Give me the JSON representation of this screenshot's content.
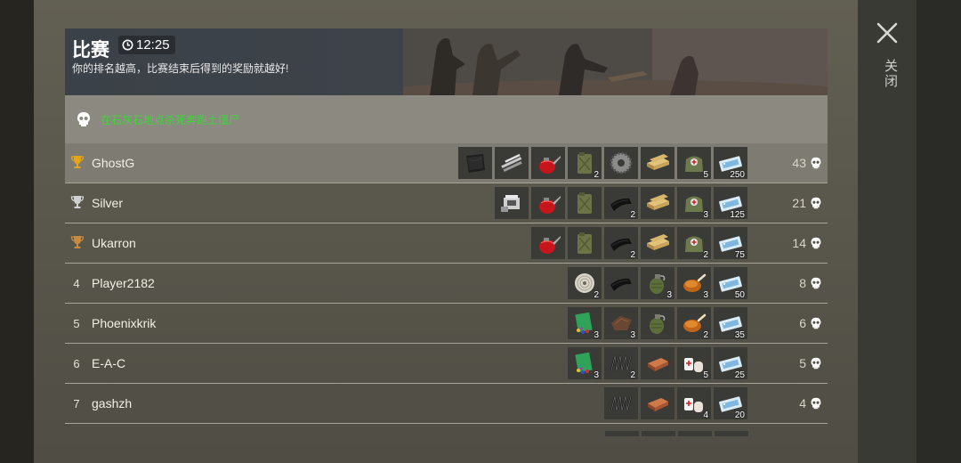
{
  "header": {
    "title": "比赛",
    "timer": "12:25",
    "subtitle": "你的排名越高，比赛结束后得到的奖励就越好!"
  },
  "task": {
    "text": "在石灰石地点杀死奔跑土僵尸"
  },
  "close": {
    "label": "关闭"
  },
  "colors": {
    "gold": "#e6a417",
    "silver": "#d0d0d0",
    "bronze": "#c88a40",
    "task_green": "#3ed43a"
  },
  "rows": [
    {
      "rank": "",
      "trophy": "gold",
      "name": "GhostG",
      "score": "43",
      "items": [
        {
          "icon": "leather-icon",
          "count": ""
        },
        {
          "icon": "pipes-icon",
          "count": ""
        },
        {
          "icon": "oil-can-icon",
          "count": ""
        },
        {
          "icon": "jerrycan-icon",
          "count": "2"
        },
        {
          "icon": "gear-icon",
          "count": ""
        },
        {
          "icon": "plank-icon",
          "count": ""
        },
        {
          "icon": "medkit-bag-icon",
          "count": "5"
        },
        {
          "icon": "coupon-icon",
          "count": "250"
        }
      ]
    },
    {
      "rank": "",
      "trophy": "silver",
      "name": "Silver",
      "score": "21",
      "items": [
        {
          "icon": "engine-icon",
          "count": ""
        },
        {
          "icon": "oil-can-icon",
          "count": ""
        },
        {
          "icon": "jerrycan-icon",
          "count": ""
        },
        {
          "icon": "cloth-icon",
          "count": "2"
        },
        {
          "icon": "plank-icon",
          "count": ""
        },
        {
          "icon": "medkit-bag-icon",
          "count": "3"
        },
        {
          "icon": "coupon-icon",
          "count": "125"
        }
      ]
    },
    {
      "rank": "",
      "trophy": "bronze",
      "name": "Ukarron",
      "score": "14",
      "items": [
        {
          "icon": "oil-can-icon",
          "count": ""
        },
        {
          "icon": "jerrycan-icon",
          "count": ""
        },
        {
          "icon": "cloth-icon",
          "count": "2"
        },
        {
          "icon": "plank-icon",
          "count": ""
        },
        {
          "icon": "medkit-bag-icon",
          "count": "2"
        },
        {
          "icon": "coupon-icon",
          "count": "75"
        }
      ]
    },
    {
      "rank": "4",
      "trophy": "",
      "name": "Player2182",
      "score": "8",
      "items": [
        {
          "icon": "wire-spool-icon",
          "count": "2"
        },
        {
          "icon": "cloth-icon",
          "count": ""
        },
        {
          "icon": "grenade-icon",
          "count": "3"
        },
        {
          "icon": "roast-chicken-icon",
          "count": "3"
        },
        {
          "icon": "coupon-icon",
          "count": "50"
        }
      ]
    },
    {
      "rank": "5",
      "trophy": "",
      "name": "Phoenixkrik",
      "score": "6",
      "items": [
        {
          "icon": "seeds-icon",
          "count": "3"
        },
        {
          "icon": "leather-scrap-icon",
          "count": "3"
        },
        {
          "icon": "grenade-icon",
          "count": ""
        },
        {
          "icon": "roast-chicken-icon",
          "count": "2"
        },
        {
          "icon": "coupon-icon",
          "count": "35"
        }
      ]
    },
    {
      "rank": "6",
      "trophy": "",
      "name": "E-A-C",
      "score": "5",
      "items": [
        {
          "icon": "seeds-icon",
          "count": "3"
        },
        {
          "icon": "spring-icon",
          "count": "2"
        },
        {
          "icon": "copper-bar-icon",
          "count": ""
        },
        {
          "icon": "bandage-icon",
          "count": "5"
        },
        {
          "icon": "coupon-icon",
          "count": "25"
        }
      ]
    },
    {
      "rank": "7",
      "trophy": "",
      "name": "gashzh",
      "score": "4",
      "items": [
        {
          "icon": "spring-icon",
          "count": ""
        },
        {
          "icon": "copper-bar-icon",
          "count": ""
        },
        {
          "icon": "bandage-icon",
          "count": "4"
        },
        {
          "icon": "coupon-icon",
          "count": "20"
        }
      ]
    }
  ]
}
